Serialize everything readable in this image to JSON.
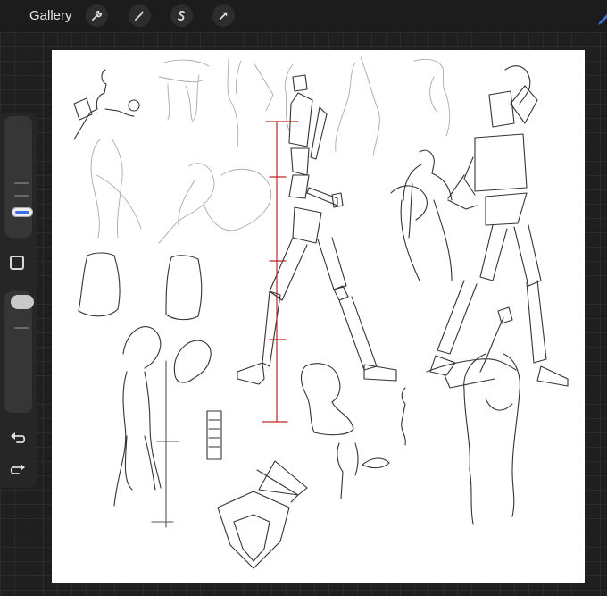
{
  "topbar": {
    "gallery_label": "Gallery",
    "tools": [
      {
        "name": "wrench-icon"
      },
      {
        "name": "magic-wand-icon"
      },
      {
        "name": "selection-s-icon"
      },
      {
        "name": "transform-arrow-icon"
      }
    ]
  },
  "sidebar": {
    "brush_size": 0.2,
    "opacity": 0.95,
    "buttons": [
      "modify-square-icon",
      "undo-icon",
      "redo-icon"
    ]
  },
  "colors": {
    "background": "#1d1d1d",
    "canvas": "#ffffff",
    "accent": "#3d6fe0",
    "measure_line": "#c0262b"
  }
}
